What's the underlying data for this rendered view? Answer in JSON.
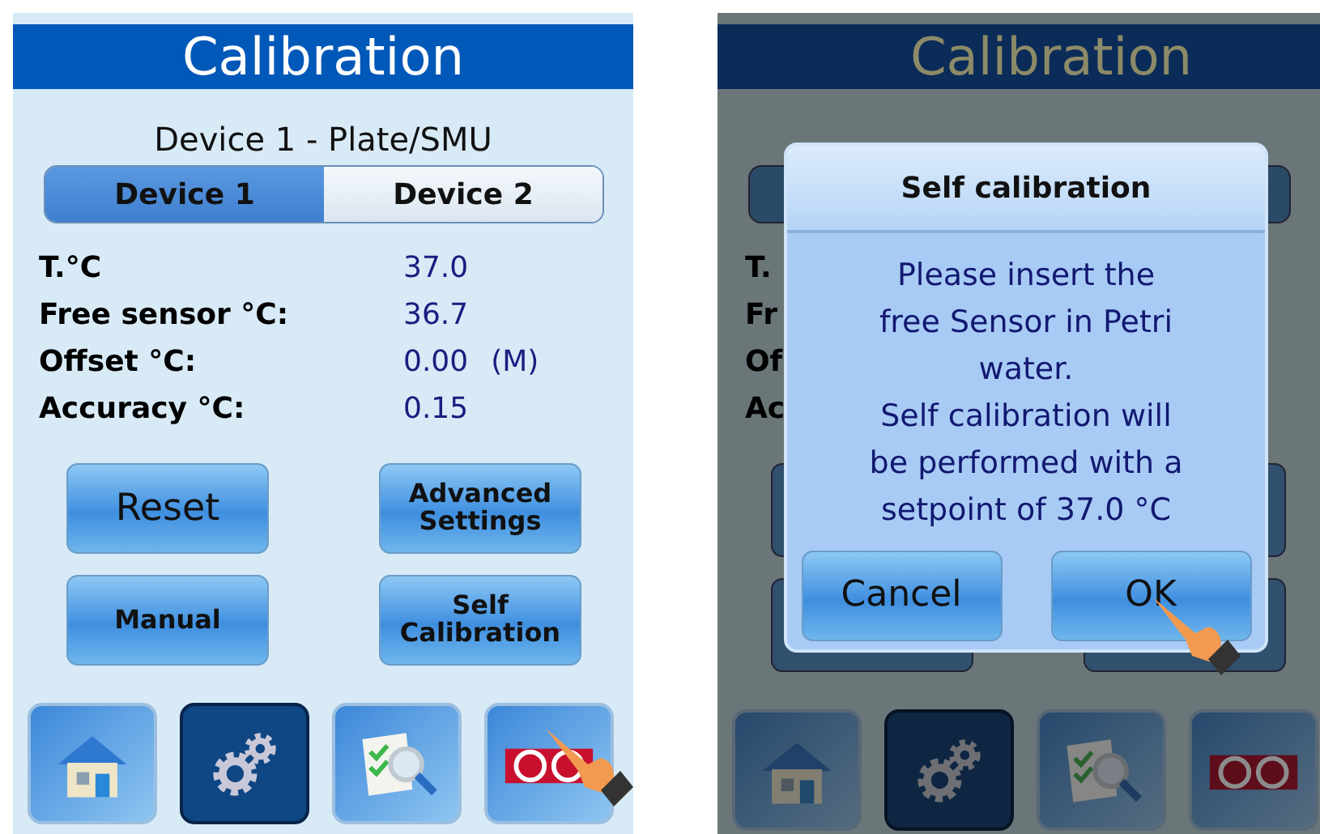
{
  "main_screen": {
    "title": "Calibration",
    "subtitle": "Device 1 - Plate/SMU",
    "tabs": [
      {
        "label": "Device 1",
        "selected": true
      },
      {
        "label": "Device 2",
        "selected": false
      }
    ],
    "readings": [
      {
        "label": "T.°C",
        "value": "37.0"
      },
      {
        "label": "Free sensor °C:",
        "value": "36.7"
      },
      {
        "label": "Offset °C:",
        "value": "0.00",
        "note": "(M)"
      },
      {
        "label": "Accuracy °C:",
        "value": "0.15"
      }
    ],
    "buttons": [
      {
        "label": "Reset",
        "kind": "large"
      },
      {
        "label": "Advanced Settings",
        "kind": "small"
      },
      {
        "label": "Manual",
        "kind": "small"
      },
      {
        "label": "Self Calibration",
        "kind": "small"
      }
    ],
    "nav": [
      {
        "kind": "home",
        "selected": false,
        "pointed": false
      },
      {
        "kind": "settings",
        "selected": true,
        "pointed": false
      },
      {
        "kind": "report",
        "selected": false,
        "pointed": false
      },
      {
        "kind": "logo",
        "selected": false,
        "pointed": true
      }
    ]
  },
  "dialog_screen": {
    "title": "Calibration",
    "label_fragments": [
      "T.",
      "Fr",
      "Of",
      "Ac"
    ],
    "nav": [
      {
        "kind": "home",
        "selected": false,
        "pointed": false
      },
      {
        "kind": "settings",
        "selected": true,
        "pointed": false
      },
      {
        "kind": "report",
        "selected": false,
        "pointed": false
      },
      {
        "kind": "logo",
        "selected": false,
        "pointed": false
      }
    ],
    "dialog": {
      "title": "Self calibration",
      "message": "Please insert the\nfree Sensor in Petri\nwater.\nSelf calibration will\nbe performed with a\nsetpoint of 37.0 °C",
      "buttons": [
        {
          "label": "Cancel",
          "pointed": false
        },
        {
          "label": "OK",
          "pointed": true
        }
      ]
    }
  }
}
